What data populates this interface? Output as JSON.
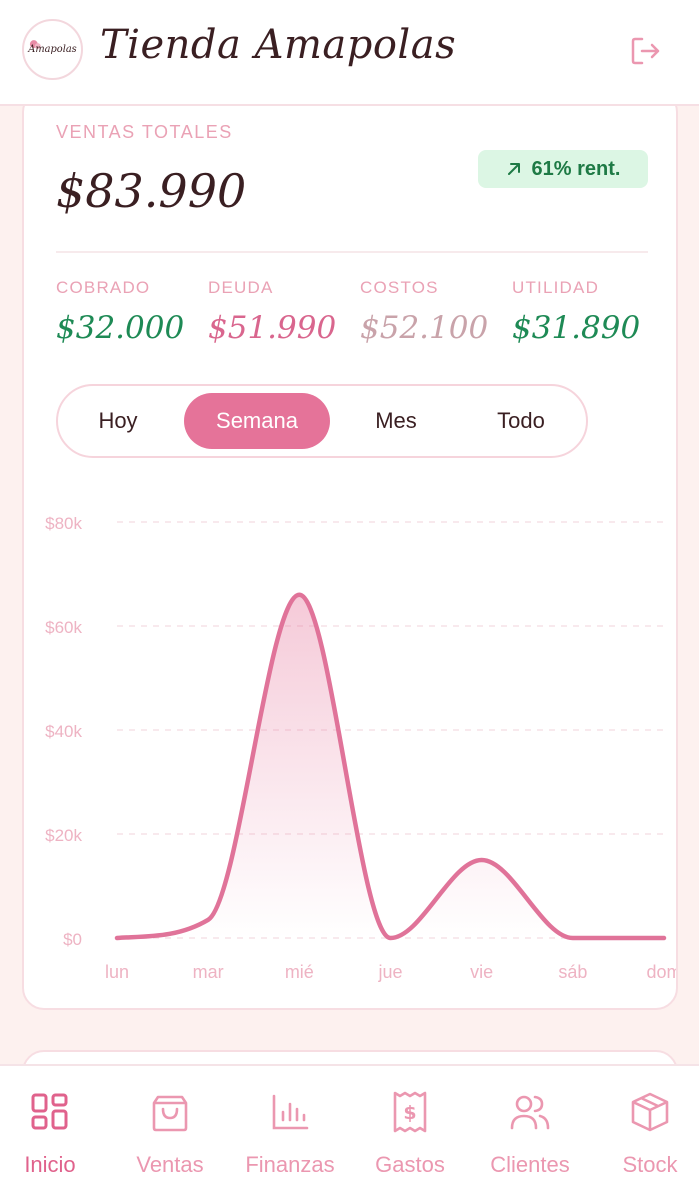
{
  "header": {
    "logo_text": "Amapolas",
    "title": "Tienda Amapolas",
    "logout_icon": "logout-icon"
  },
  "summary": {
    "label": "VENTAS TOTALES",
    "total": "$83.990",
    "badge": "61% rent.",
    "badge_icon": "arrow-up-right-icon"
  },
  "stats": [
    {
      "label": "COBRADO",
      "value": "$32.000",
      "color": "#1e8a55"
    },
    {
      "label": "DEUDA",
      "value": "$51.990",
      "color": "#d9668e"
    },
    {
      "label": "COSTOS",
      "value": "$52.100",
      "color": "#c9a3aa"
    },
    {
      "label": "UTILIDAD",
      "value": "$31.890",
      "color": "#1e8a55"
    }
  ],
  "period_tabs": [
    {
      "label": "Hoy",
      "active": false
    },
    {
      "label": "Semana",
      "active": true
    },
    {
      "label": "Mes",
      "active": false
    },
    {
      "label": "Todo",
      "active": false
    }
  ],
  "chart_data": {
    "type": "area",
    "categories": [
      "lun",
      "mar",
      "mié",
      "jue",
      "vie",
      "sáb",
      "dom"
    ],
    "values": [
      0,
      3500,
      66000,
      0,
      15000,
      0,
      0
    ],
    "ylim": [
      0,
      80000
    ],
    "yticks": [
      "$0",
      "$20k",
      "$40k",
      "$60k",
      "$80k"
    ],
    "grid": true,
    "color": "#e07399"
  },
  "nav": [
    {
      "label": "Inicio",
      "icon": "dashboard-icon",
      "active": true
    },
    {
      "label": "Ventas",
      "icon": "shopping-bag-icon",
      "active": false
    },
    {
      "label": "Finanzas",
      "icon": "bar-chart-icon",
      "active": false
    },
    {
      "label": "Gastos",
      "icon": "receipt-icon",
      "active": false
    },
    {
      "label": "Clientes",
      "icon": "users-icon",
      "active": false
    },
    {
      "label": "Stock",
      "icon": "package-icon",
      "active": false
    }
  ]
}
